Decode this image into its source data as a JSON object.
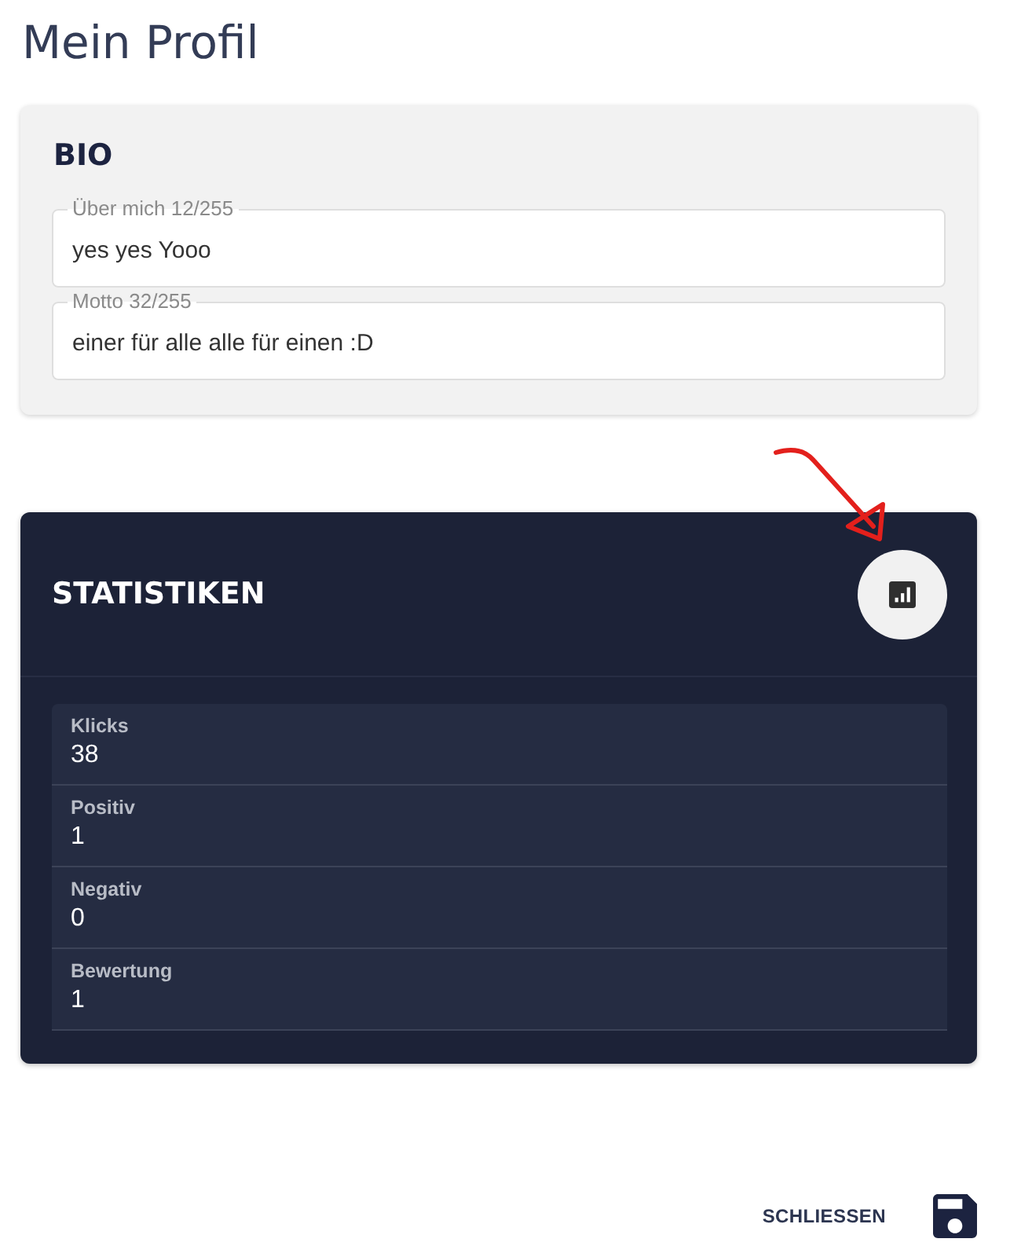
{
  "title": "Mein Profil",
  "bio": {
    "heading": "BIO",
    "fields": [
      {
        "label": "Über mich 12/255",
        "value": "yes yes Yooo"
      },
      {
        "label": "Motto 32/255",
        "value": "einer für alle alle für einen :D"
      }
    ]
  },
  "statistics": {
    "heading": "STATISTIKEN",
    "items": [
      {
        "label": "Klicks",
        "value": "38"
      },
      {
        "label": "Positiv",
        "value": "1"
      },
      {
        "label": "Negativ",
        "value": "0"
      },
      {
        "label": "Bewertung",
        "value": "1"
      }
    ]
  },
  "actions": {
    "close": "SCHLIESSEN"
  }
}
